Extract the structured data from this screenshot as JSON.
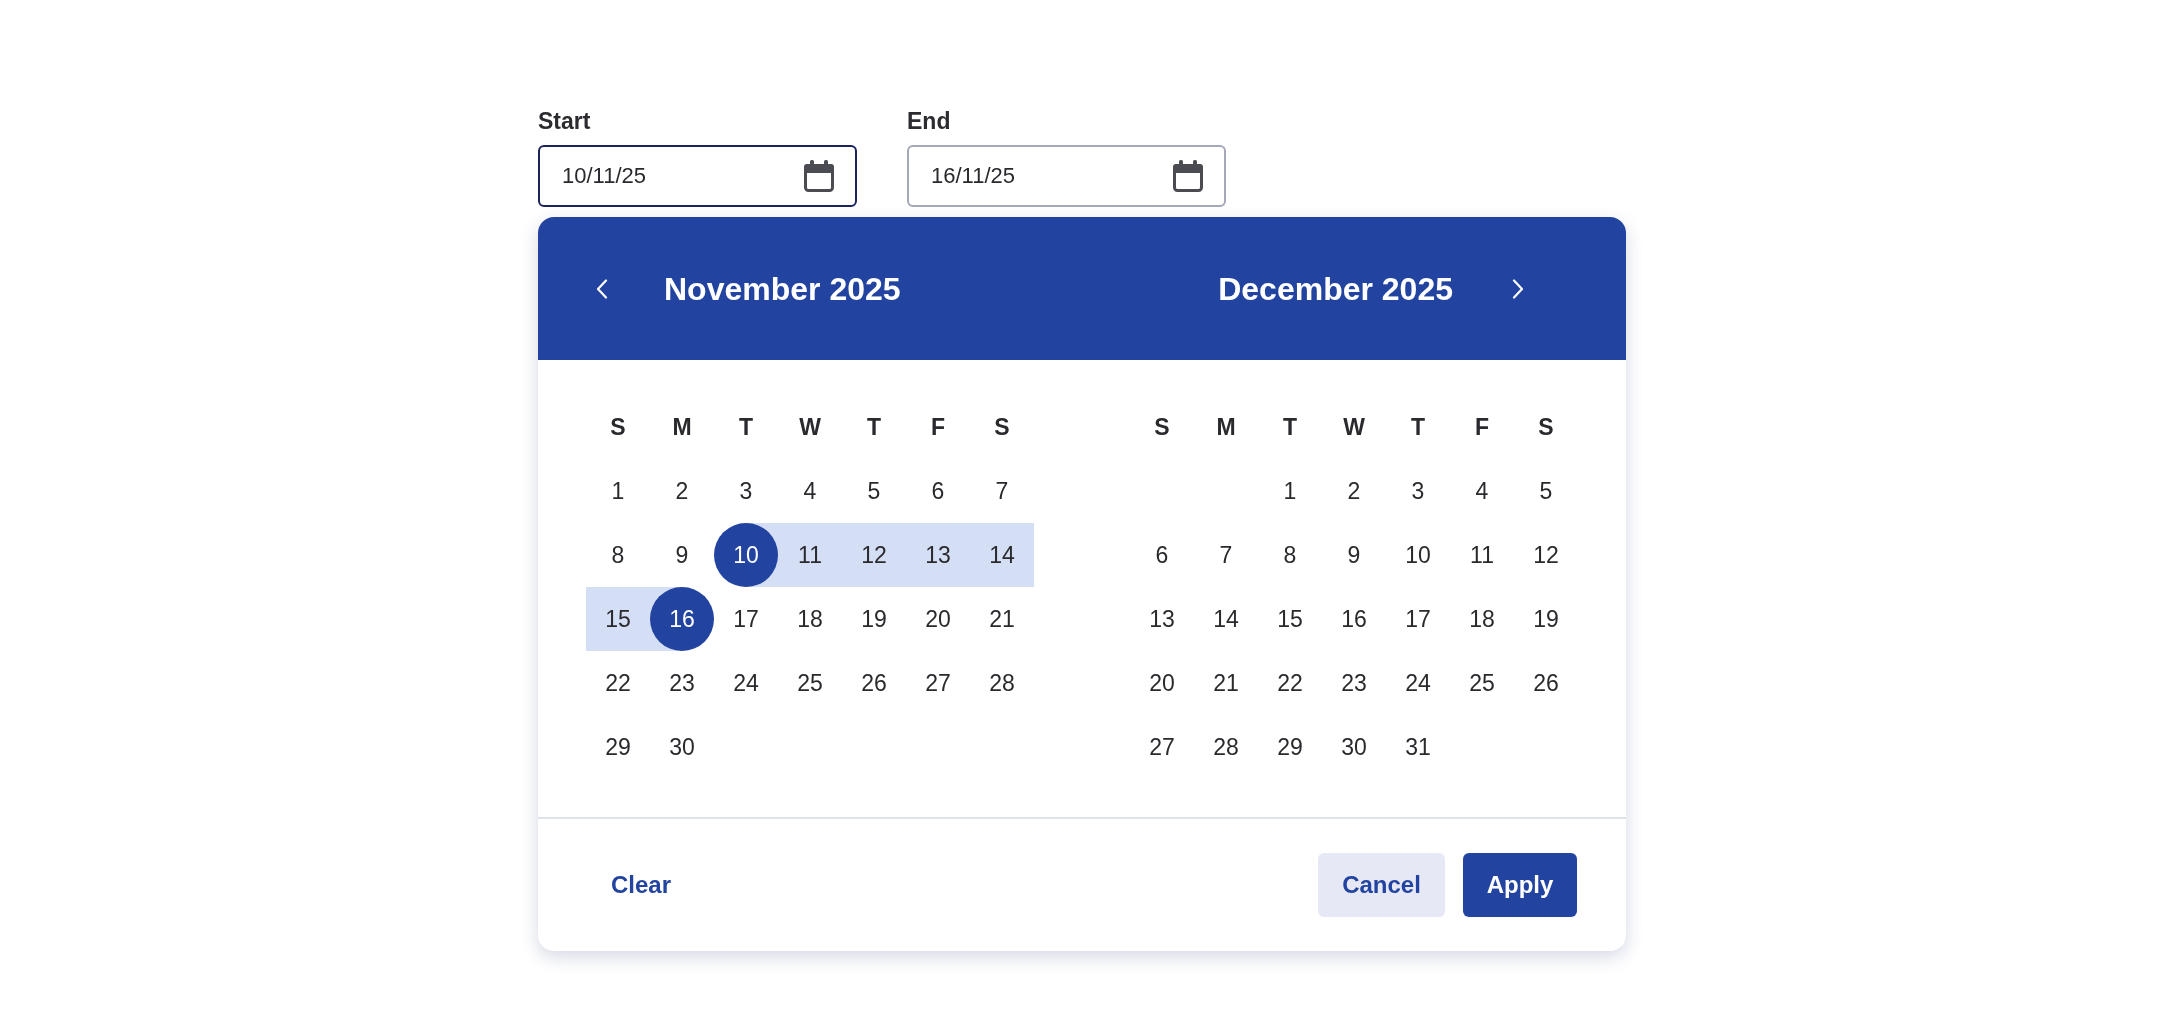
{
  "fields": [
    {
      "label": "Start",
      "value": "10/11/25",
      "focused": true
    },
    {
      "label": "End",
      "value": "16/11/25",
      "focused": false
    }
  ],
  "months": [
    {
      "title": "November 2025",
      "weekdays": [
        "S",
        "M",
        "T",
        "W",
        "T",
        "F",
        "S"
      ],
      "weeks": [
        [
          {
            "day": "1",
            "selected": false,
            "in_range": false
          },
          {
            "day": "2",
            "selected": false,
            "in_range": false
          },
          {
            "day": "3",
            "selected": false,
            "in_range": false
          },
          {
            "day": "4",
            "selected": false,
            "in_range": false
          },
          {
            "day": "5",
            "selected": false,
            "in_range": false
          },
          {
            "day": "6",
            "selected": false,
            "in_range": false
          },
          {
            "day": "7",
            "selected": false,
            "in_range": false
          }
        ],
        [
          {
            "day": "8",
            "selected": false,
            "in_range": false
          },
          {
            "day": "9",
            "selected": false,
            "in_range": false
          },
          {
            "day": "10",
            "selected": true,
            "in_range": false
          },
          {
            "day": "11",
            "selected": false,
            "in_range": true
          },
          {
            "day": "12",
            "selected": false,
            "in_range": true
          },
          {
            "day": "13",
            "selected": false,
            "in_range": true
          },
          {
            "day": "14",
            "selected": false,
            "in_range": true
          }
        ],
        [
          {
            "day": "15",
            "selected": false,
            "in_range": true
          },
          {
            "day": "16",
            "selected": true,
            "in_range": false
          },
          {
            "day": "17",
            "selected": false,
            "in_range": false
          },
          {
            "day": "18",
            "selected": false,
            "in_range": false
          },
          {
            "day": "19",
            "selected": false,
            "in_range": false
          },
          {
            "day": "20",
            "selected": false,
            "in_range": false
          },
          {
            "day": "21",
            "selected": false,
            "in_range": false
          }
        ],
        [
          {
            "day": "22",
            "selected": false,
            "in_range": false
          },
          {
            "day": "23",
            "selected": false,
            "in_range": false
          },
          {
            "day": "24",
            "selected": false,
            "in_range": false
          },
          {
            "day": "25",
            "selected": false,
            "in_range": false
          },
          {
            "day": "26",
            "selected": false,
            "in_range": false
          },
          {
            "day": "27",
            "selected": false,
            "in_range": false
          },
          {
            "day": "28",
            "selected": false,
            "in_range": false
          }
        ],
        [
          {
            "day": "29",
            "selected": false,
            "in_range": false
          },
          {
            "day": "30",
            "selected": false,
            "in_range": false
          }
        ]
      ]
    },
    {
      "title": "December 2025",
      "weekdays": [
        "S",
        "M",
        "T",
        "W",
        "T",
        "F",
        "S"
      ],
      "weeks": [
        [
          {
            "day": "1",
            "selected": false,
            "in_range": false
          },
          {
            "day": "2",
            "selected": false,
            "in_range": false
          },
          {
            "day": "3",
            "selected": false,
            "in_range": false
          },
          {
            "day": "4",
            "selected": false,
            "in_range": false
          },
          {
            "day": "5",
            "selected": false,
            "in_range": false
          }
        ],
        [
          {
            "day": "6",
            "selected": false,
            "in_range": false
          },
          {
            "day": "7",
            "selected": false,
            "in_range": false
          },
          {
            "day": "8",
            "selected": false,
            "in_range": false
          },
          {
            "day": "9",
            "selected": false,
            "in_range": false
          },
          {
            "day": "10",
            "selected": false,
            "in_range": false
          },
          {
            "day": "11",
            "selected": false,
            "in_range": false
          },
          {
            "day": "12",
            "selected": false,
            "in_range": false
          }
        ],
        [
          {
            "day": "13",
            "selected": false,
            "in_range": false
          },
          {
            "day": "14",
            "selected": false,
            "in_range": false
          },
          {
            "day": "15",
            "selected": false,
            "in_range": false
          },
          {
            "day": "16",
            "selected": false,
            "in_range": false
          },
          {
            "day": "17",
            "selected": false,
            "in_range": false
          },
          {
            "day": "18",
            "selected": false,
            "in_range": false
          },
          {
            "day": "19",
            "selected": false,
            "in_range": false
          }
        ],
        [
          {
            "day": "20",
            "selected": false,
            "in_range": false
          },
          {
            "day": "21",
            "selected": false,
            "in_range": false
          },
          {
            "day": "22",
            "selected": false,
            "in_range": false
          },
          {
            "day": "23",
            "selected": false,
            "in_range": false
          },
          {
            "day": "24",
            "selected": false,
            "in_range": false
          },
          {
            "day": "25",
            "selected": false,
            "in_range": false
          },
          {
            "day": "26",
            "selected": false,
            "in_range": false
          }
        ],
        [
          {
            "day": "27",
            "selected": false,
            "in_range": false
          },
          {
            "day": "28",
            "selected": false,
            "in_range": false
          },
          {
            "day": "29",
            "selected": false,
            "in_range": false
          },
          {
            "day": "30",
            "selected": false,
            "in_range": false
          },
          {
            "day": "31",
            "selected": false,
            "in_range": false
          }
        ]
      ]
    }
  ],
  "footer": {
    "actions": [
      {
        "label": "Clear",
        "kind": "link"
      },
      {
        "label": "Cancel",
        "kind": "secondary"
      },
      {
        "label": "Apply",
        "kind": "primary"
      }
    ]
  }
}
